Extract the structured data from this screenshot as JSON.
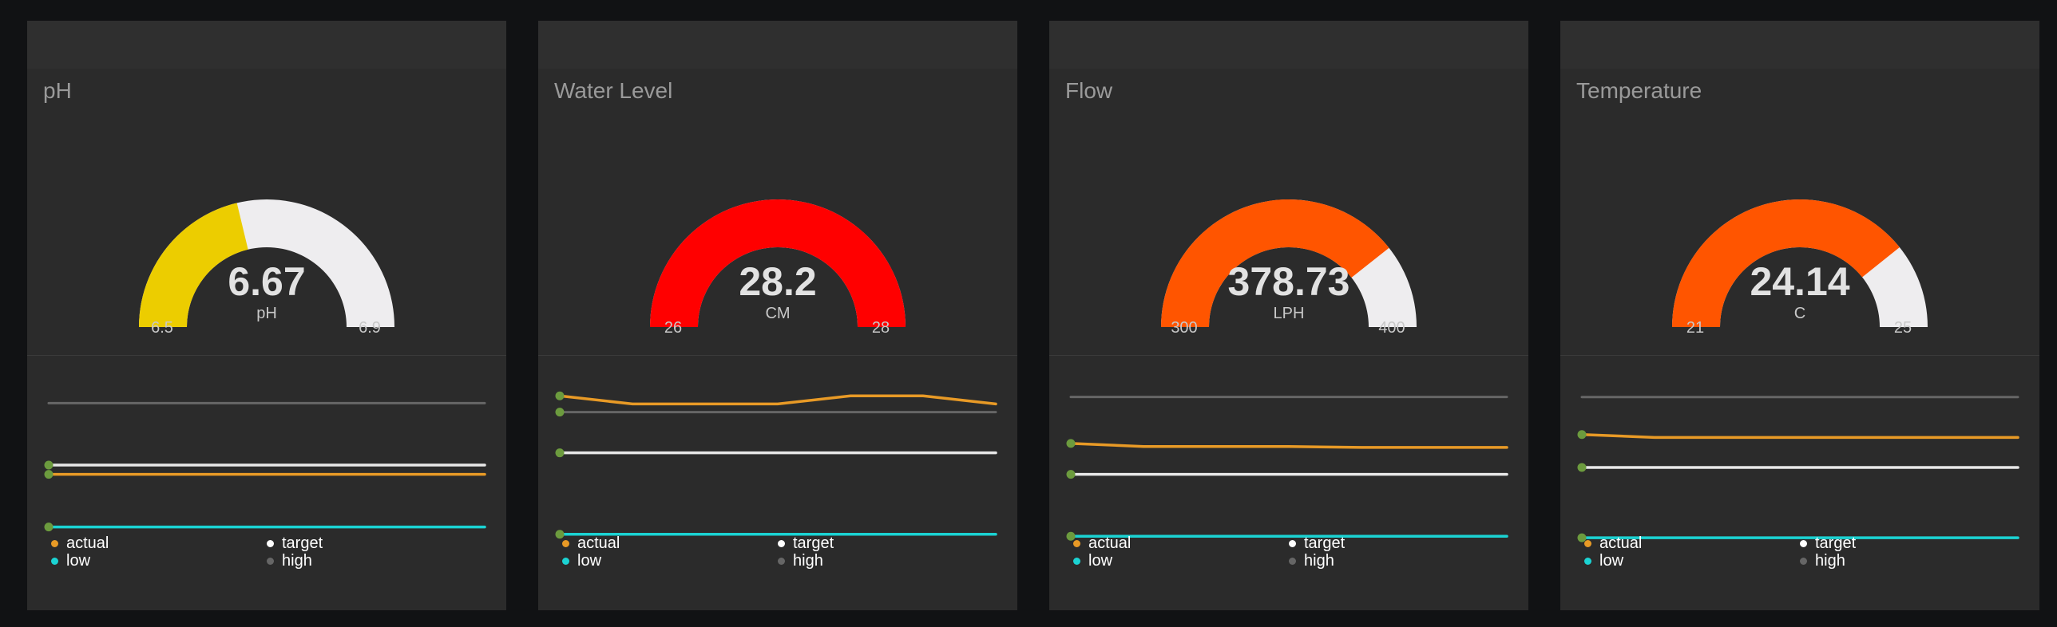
{
  "colors": {
    "background": "#111214",
    "card": "#2b2b2b",
    "actual": "#e89a26",
    "target": "#e8e8e8",
    "low": "#1bd3d3",
    "high": "#666666",
    "point": "#6c9b3e"
  },
  "legend": {
    "actual": "actual",
    "target": "target",
    "low": "low",
    "high": "high"
  },
  "cards": [
    {
      "title": "pH",
      "gauge": {
        "value": "6.67",
        "unit": "pH",
        "min": "6.5",
        "max": "6.9",
        "fill_fraction": 0.425,
        "fill_color": "#eccd00",
        "track_color": "#eeedef"
      },
      "chart_data": {
        "type": "line",
        "series": [
          {
            "name": "actual",
            "values": [
              6.67,
              6.67,
              6.67,
              6.67,
              6.67,
              6.67,
              6.67
            ]
          },
          {
            "name": "target",
            "values": [
              6.7,
              6.7,
              6.7,
              6.7,
              6.7,
              6.7,
              6.7
            ]
          },
          {
            "name": "low",
            "values": [
              6.5,
              6.5,
              6.5,
              6.5,
              6.5,
              6.5,
              6.5
            ]
          },
          {
            "name": "high",
            "values": [
              6.9,
              6.9,
              6.9,
              6.9,
              6.9,
              6.9,
              6.9
            ]
          }
        ],
        "ylim": [
          6.45,
          6.95
        ]
      }
    },
    {
      "title": "Water Level",
      "gauge": {
        "value": "28.2",
        "unit": "CM",
        "min": "26",
        "max": "28",
        "fill_fraction": 1.0,
        "fill_color": "#ff0000",
        "track_color": "#eeedef"
      },
      "chart_data": {
        "type": "line",
        "series": [
          {
            "name": "actual",
            "values": [
              28.2,
              28.1,
              28.1,
              28.1,
              28.2,
              28.2,
              28.1
            ]
          },
          {
            "name": "target",
            "values": [
              27.5,
              27.5,
              27.5,
              27.5,
              27.5,
              27.5,
              27.5
            ]
          },
          {
            "name": "low",
            "values": [
              26.5,
              26.5,
              26.5,
              26.5,
              26.5,
              26.5,
              26.5
            ]
          },
          {
            "name": "high",
            "values": [
              28,
              28,
              28,
              28,
              28,
              28,
              28
            ]
          }
        ],
        "ylim": [
          26.4,
          28.3
        ]
      }
    },
    {
      "title": "Flow",
      "gauge": {
        "value": "378.73",
        "unit": "LPH",
        "min": "300",
        "max": "400",
        "fill_fraction": 0.787,
        "fill_color": "#ff5500",
        "track_color": "#eeedef"
      },
      "chart_data": {
        "type": "line",
        "series": [
          {
            "name": "actual",
            "values": [
              380,
              379,
              379,
              379,
              378.7,
              378.7,
              378.7
            ]
          },
          {
            "name": "target",
            "values": [
              370,
              370,
              370,
              370,
              370,
              370,
              370
            ]
          },
          {
            "name": "low",
            "values": [
              350,
              350,
              350,
              350,
              350,
              350,
              350
            ]
          },
          {
            "name": "high",
            "values": [
              395,
              395,
              395,
              395,
              395,
              395,
              395
            ]
          }
        ],
        "ylim": [
          348,
          398
        ]
      }
    },
    {
      "title": "Temperature",
      "gauge": {
        "value": "24.14",
        "unit": "C",
        "min": "21",
        "max": "25",
        "fill_fraction": 0.785,
        "fill_color": "#ff5500",
        "track_color": "#eeedef"
      },
      "chart_data": {
        "type": "line",
        "series": [
          {
            "name": "actual",
            "values": [
              24.2,
              24.14,
              24.14,
              24.14,
              24.14,
              24.14,
              24.14
            ]
          },
          {
            "name": "target",
            "values": [
              23.5,
              23.5,
              23.5,
              23.5,
              23.5,
              23.5,
              23.5
            ]
          },
          {
            "name": "low",
            "values": [
              22,
              22,
              22,
              22,
              22,
              22,
              22
            ]
          },
          {
            "name": "high",
            "values": [
              25,
              25,
              25,
              25,
              25,
              25,
              25
            ]
          }
        ],
        "ylim": [
          21.9,
          25.2
        ]
      }
    }
  ]
}
